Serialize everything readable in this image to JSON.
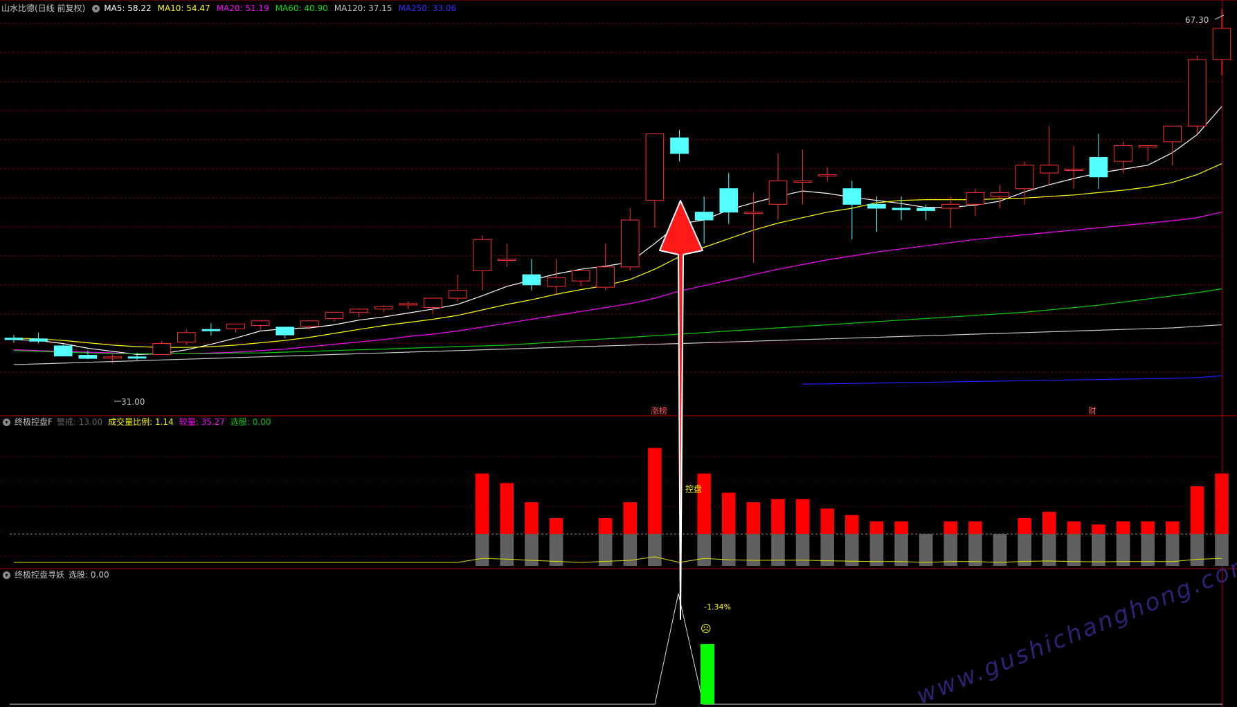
{
  "main": {
    "title": "山水比德(日线 前复权)",
    "ma": [
      {
        "label": "MA5: 58.22",
        "color": "#ffffff"
      },
      {
        "label": "MA10: 54.47",
        "color": "#ffff00"
      },
      {
        "label": "MA20: 51.19",
        "color": "#ff00ff"
      },
      {
        "label": "MA60: 40.90",
        "color": "#00e000"
      },
      {
        "label": "MA120: 37.15",
        "color": "#c8c8c8"
      },
      {
        "label": "MA250: 33.06",
        "color": "#3030ff"
      }
    ],
    "price_high": "67.30",
    "price_low": "31.00",
    "mark_zhangting": "涨榜",
    "mark_cai": "财"
  },
  "panel1": {
    "title": "终极控盘F",
    "items": [
      {
        "label": "警戒: 13.00",
        "color": "#666666"
      },
      {
        "label": "成交量比例: 1.14",
        "color": "#ffff00"
      },
      {
        "label": "较量: 35.27",
        "color": "#ff00ff"
      },
      {
        "label": "选股: 0.00",
        "color": "#00c800"
      }
    ],
    "signal_label": "控盘"
  },
  "panel2": {
    "title": "终极控盘寻妖",
    "items": [
      {
        "label": "选股: 0.00",
        "color": "#c8c8c8"
      }
    ],
    "pct_label": "-1.34%",
    "face": "☹"
  },
  "watermark": "www.gushichanghong.com",
  "chart_data": {
    "type": "candlestick",
    "candles": [
      {
        "o": 37.9,
        "h": 38.3,
        "l": 37.3,
        "c": 37.7
      },
      {
        "o": 37.8,
        "h": 38.6,
        "l": 37.2,
        "c": 37.5
      },
      {
        "o": 36.9,
        "h": 37.1,
        "l": 35.7,
        "c": 35.6
      },
      {
        "o": 35.7,
        "h": 36.3,
        "l": 35.2,
        "c": 35.3
      },
      {
        "o": 35.4,
        "h": 35.8,
        "l": 34.7,
        "c": 35.5
      },
      {
        "o": 35.5,
        "h": 36.0,
        "l": 35.1,
        "c": 35.4
      },
      {
        "o": 35.8,
        "h": 37.5,
        "l": 35.8,
        "c": 37.2
      },
      {
        "o": 37.4,
        "h": 39.0,
        "l": 37.0,
        "c": 38.6
      },
      {
        "o": 39.0,
        "h": 39.8,
        "l": 38.2,
        "c": 38.9
      },
      {
        "o": 39.1,
        "h": 39.6,
        "l": 38.6,
        "c": 39.7
      },
      {
        "o": 39.5,
        "h": 40.1,
        "l": 38.9,
        "c": 40.1
      },
      {
        "o": 39.3,
        "h": 39.3,
        "l": 37.9,
        "c": 38.3
      },
      {
        "o": 39.4,
        "h": 40.0,
        "l": 39.0,
        "c": 40.1
      },
      {
        "o": 40.4,
        "h": 41.1,
        "l": 40.0,
        "c": 41.2
      },
      {
        "o": 41.2,
        "h": 41.7,
        "l": 40.6,
        "c": 41.6
      },
      {
        "o": 41.6,
        "h": 42.1,
        "l": 41.2,
        "c": 41.9
      },
      {
        "o": 42.2,
        "h": 42.6,
        "l": 41.6,
        "c": 42.3
      },
      {
        "o": 41.8,
        "h": 43.0,
        "l": 41.0,
        "c": 43.0
      },
      {
        "o": 43.0,
        "h": 46.0,
        "l": 42.5,
        "c": 44.0
      },
      {
        "o": 46.5,
        "h": 51.0,
        "l": 44.0,
        "c": 50.5
      },
      {
        "o": 48.0,
        "h": 50.0,
        "l": 47.0,
        "c": 48.0
      },
      {
        "o": 46.0,
        "h": 48.0,
        "l": 44.0,
        "c": 44.7
      },
      {
        "o": 44.5,
        "h": 48.0,
        "l": 43.5,
        "c": 45.6
      },
      {
        "o": 45.2,
        "h": 46.5,
        "l": 44.5,
        "c": 46.5
      },
      {
        "o": 44.4,
        "h": 50.0,
        "l": 44.0,
        "c": 47.0
      },
      {
        "o": 47.0,
        "h": 54.5,
        "l": 46.5,
        "c": 53.0
      },
      {
        "o": 55.5,
        "h": 63.5,
        "l": 52.0,
        "c": 64.0
      },
      {
        "o": 63.5,
        "h": 64.5,
        "l": 60.5,
        "c": 61.5
      },
      {
        "o": 54.0,
        "h": 56.0,
        "l": 50.0,
        "c": 53.0
      },
      {
        "o": 57.0,
        "h": 59.0,
        "l": 52.5,
        "c": 54.0
      },
      {
        "o": 54.0,
        "h": 56.5,
        "l": 47.5,
        "c": 54.0
      },
      {
        "o": 55.0,
        "h": 61.5,
        "l": 53.0,
        "c": 58.0
      },
      {
        "o": 58.0,
        "h": 62.0,
        "l": 55.0,
        "c": 58.0
      },
      {
        "o": 58.7,
        "h": 59.7,
        "l": 58.0,
        "c": 58.8
      },
      {
        "o": 57.0,
        "h": 58.0,
        "l": 50.5,
        "c": 55.0
      },
      {
        "o": 55.0,
        "h": 56.0,
        "l": 51.5,
        "c": 54.5
      },
      {
        "o": 54.5,
        "h": 56.0,
        "l": 53.0,
        "c": 54.3
      },
      {
        "o": 54.5,
        "h": 55.0,
        "l": 53.0,
        "c": 54.2
      },
      {
        "o": 54.5,
        "h": 56.0,
        "l": 52.0,
        "c": 55.0
      },
      {
        "o": 55.0,
        "h": 57.0,
        "l": 53.5,
        "c": 56.5
      },
      {
        "o": 56.0,
        "h": 57.5,
        "l": 54.5,
        "c": 56.5
      },
      {
        "o": 57.0,
        "h": 60.5,
        "l": 55.0,
        "c": 60.0
      },
      {
        "o": 59.0,
        "h": 65.0,
        "l": 57.5,
        "c": 60.0
      },
      {
        "o": 59.5,
        "h": 62.5,
        "l": 57.0,
        "c": 59.5
      },
      {
        "o": 61.0,
        "h": 64.0,
        "l": 57.0,
        "c": 58.5
      },
      {
        "o": 60.5,
        "h": 63.0,
        "l": 59.0,
        "c": 62.5
      },
      {
        "o": 62.5,
        "h": 62.5,
        "l": 60.5,
        "c": 62.5
      },
      {
        "o": 63.0,
        "h": 64.5,
        "l": 60.0,
        "c": 65.0
      },
      {
        "o": 65.0,
        "h": 74.0,
        "l": 64.0,
        "c": 73.5
      },
      {
        "o": 73.5,
        "h": 80.0,
        "l": 71.5,
        "c": 77.5
      }
    ],
    "ylim": [
      30,
      79
    ],
    "ma_lines": {
      "MA5": [
        37.7,
        37.6,
        37.2,
        36.6,
        36.2,
        35.8,
        35.9,
        36.4,
        37.1,
        37.9,
        38.8,
        39.1,
        39.2,
        39.6,
        40.2,
        40.6,
        41.1,
        41.6,
        42.2,
        43.3,
        44.5,
        45.3,
        46.1,
        46.7,
        47.1,
        47.6,
        50.0,
        52.5,
        53.0,
        54.3,
        55.2,
        56.0,
        56.7,
        56.4,
        55.9,
        55.5,
        55.1,
        54.6,
        54.6,
        54.9,
        55.4,
        56.6,
        57.5,
        58.3,
        59.0,
        59.5,
        60.0,
        61.6,
        63.9,
        67.5
      ],
      "MA10": [
        37.9,
        37.8,
        37.6,
        37.3,
        37.0,
        36.8,
        36.7,
        36.7,
        36.8,
        37.0,
        37.3,
        37.6,
        38.0,
        38.5,
        39.0,
        39.5,
        39.9,
        40.3,
        40.8,
        41.5,
        42.2,
        42.8,
        43.5,
        44.1,
        44.6,
        45.4,
        46.7,
        48.3,
        49.5,
        50.6,
        51.7,
        52.6,
        53.3,
        54.0,
        54.5,
        55.2,
        55.5,
        55.6,
        55.6,
        55.6,
        55.7,
        55.8,
        56.0,
        56.2,
        56.5,
        56.8,
        57.2,
        57.8,
        58.8,
        60.2
      ],
      "MA20": [
        36.4,
        36.3,
        36.2,
        36.1,
        36.0,
        35.9,
        35.9,
        35.9,
        36.0,
        36.1,
        36.3,
        36.5,
        36.8,
        37.1,
        37.4,
        37.7,
        38.1,
        38.4,
        38.8,
        39.3,
        39.8,
        40.3,
        40.8,
        41.3,
        41.8,
        42.3,
        43.0,
        43.9,
        44.6,
        45.3,
        46.0,
        46.7,
        47.3,
        47.9,
        48.4,
        48.9,
        49.3,
        49.7,
        50.1,
        50.5,
        50.8,
        51.1,
        51.4,
        51.7,
        52.0,
        52.3,
        52.6,
        52.9,
        53.3,
        54.0
      ],
      "MA60": [
        36.3,
        36.2,
        36.1,
        36.0,
        35.9,
        35.9,
        35.9,
        35.9,
        35.9,
        36.0,
        36.0,
        36.1,
        36.2,
        36.3,
        36.4,
        36.5,
        36.6,
        36.7,
        36.8,
        36.9,
        37.0,
        37.2,
        37.4,
        37.6,
        37.8,
        38.0,
        38.2,
        38.4,
        38.6,
        38.8,
        39.0,
        39.2,
        39.4,
        39.6,
        39.8,
        40.0,
        40.2,
        40.4,
        40.6,
        40.8,
        41.0,
        41.2,
        41.5,
        41.8,
        42.1,
        42.5,
        42.9,
        43.3,
        43.7,
        44.2
      ],
      "MA120": [
        34.5,
        34.6,
        34.7,
        34.8,
        34.9,
        35.0,
        35.1,
        35.2,
        35.3,
        35.4,
        35.5,
        35.6,
        35.7,
        35.8,
        35.9,
        36.0,
        36.1,
        36.2,
        36.3,
        36.4,
        36.5,
        36.6,
        36.7,
        36.8,
        36.9,
        37.0,
        37.1,
        37.2,
        37.3,
        37.4,
        37.5,
        37.6,
        37.7,
        37.8,
        37.9,
        38.0,
        38.1,
        38.2,
        38.3,
        38.4,
        38.5,
        38.6,
        38.7,
        38.8,
        38.9,
        39.0,
        39.1,
        39.2,
        39.4,
        39.6
      ]
    },
    "ma250_start_index": 32,
    "ma250": [
      32.0,
      32.05,
      32.1,
      32.15,
      32.2,
      32.25,
      32.3,
      32.35,
      32.4,
      32.45,
      32.5,
      32.55,
      32.6,
      32.65,
      32.7,
      32.75,
      32.85,
      33.06
    ],
    "panel1_bars": [
      0,
      0,
      0,
      0,
      0,
      0,
      0,
      0,
      0,
      0,
      0,
      0,
      0,
      0,
      0,
      0,
      0,
      0,
      0,
      1.9,
      1.6,
      1.0,
      0.5,
      0,
      0.5,
      1.0,
      2.7,
      0,
      1.9,
      1.3,
      1.0,
      1.1,
      1.1,
      0.8,
      0.6,
      0.4,
      0.4,
      0,
      0.4,
      0.4,
      0,
      0.5,
      0.7,
      0.4,
      0.3,
      0.4,
      0.4,
      0.4,
      1.5,
      1.9
    ],
    "panel1_gray": [
      0,
      0,
      0,
      0,
      0,
      0,
      0,
      0,
      0,
      0,
      0,
      0,
      0,
      0,
      0,
      0,
      0,
      0,
      0,
      1,
      1,
      1,
      1,
      0,
      1,
      1,
      1,
      0,
      1,
      1,
      1,
      1,
      1,
      1,
      1,
      1,
      1,
      1,
      1,
      1,
      1,
      1,
      1,
      1,
      1,
      1,
      1,
      1,
      1,
      1
    ],
    "panel1_ylim": [
      0,
      3.6
    ]
  }
}
